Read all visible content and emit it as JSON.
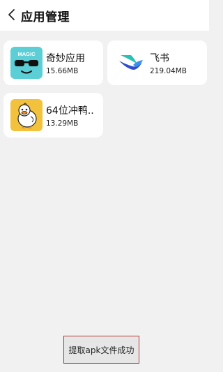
{
  "header": {
    "title": "应用管理",
    "back_icon": "chevron-left-icon"
  },
  "apps": [
    {
      "name": "奇妙应用",
      "size": "15.66MB",
      "icon": "magic-app-icon",
      "icon_text": "MAGIC",
      "icon_color": "#5ccfd6"
    },
    {
      "name": "飞书",
      "size": "219.04MB",
      "icon": "feishu-app-icon"
    },
    {
      "name": "64位冲鸭..",
      "size": "13.29MB",
      "icon": "duck-app-icon",
      "icon_color": "#f3c23c"
    }
  ],
  "toast": {
    "text": "提取apk文件成功"
  }
}
